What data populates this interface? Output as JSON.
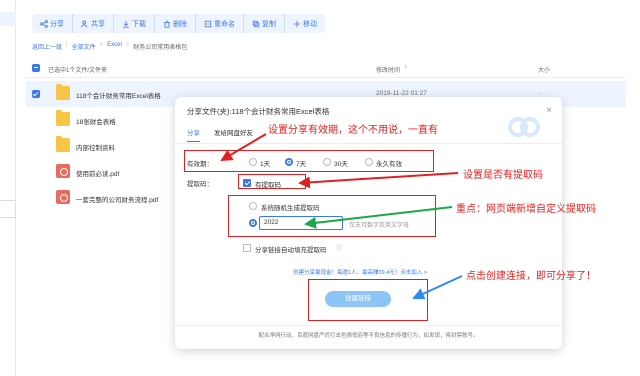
{
  "toolbar": {
    "buttons": [
      {
        "label": "分享",
        "icon": "share-icon"
      },
      {
        "label": "共享",
        "icon": "people-icon"
      },
      {
        "label": "下载",
        "icon": "download-icon"
      },
      {
        "label": "删除",
        "icon": "trash-icon"
      },
      {
        "label": "重命名",
        "icon": "rename-icon"
      },
      {
        "label": "复制",
        "icon": "copy-icon"
      },
      {
        "label": "移动",
        "icon": "move-icon"
      }
    ]
  },
  "breadcrumb": {
    "back": "返回上一级",
    "all": "全部文件",
    "excel": "Excel",
    "current": "财务公司常用表格包"
  },
  "list": {
    "selected_count": "已选中1个文件/文件夹",
    "col_date": "修改时间",
    "col_size": "大小",
    "rows": [
      {
        "name": "118个会计财务常用Excel表格",
        "date": "2019-11-22 01:27",
        "size": "-",
        "type": "folder",
        "selected": true
      },
      {
        "name": "18张财会表格",
        "type": "folder"
      },
      {
        "name": "内部控制资料",
        "type": "folder"
      },
      {
        "name": "使用前必读.pdf",
        "type": "pdf"
      },
      {
        "name": "一套完整的公司财务流程.pdf",
        "type": "pdf"
      }
    ]
  },
  "dialog": {
    "title": "分享文件(夹):118个会计财务常用Excel表格",
    "tabs": [
      "分享",
      "发给网盘好友"
    ],
    "validity_label": "有效期：",
    "validity_options": [
      "1天",
      "7天",
      "30天",
      "永久有效"
    ],
    "extract_label": "提取码：",
    "has_extract": "有提取码",
    "random_code": "系统随机生成提取码",
    "custom_code_value": "2022",
    "custom_code_hint": "仅支持数字及英文字母",
    "auto_fill": "分享链接自动填充提取码",
    "promo": "创建分享赢现金！每邀1人，最高赚39.4元！点击加入 >",
    "create_button": "创建链接",
    "footer": "配合净网行动，百度网盘严厉打击色情低俗等不良信息的传播行为，如发现，将封禁账号。"
  },
  "annotations": {
    "a1": "设置分享有效期，这个不用说，一直有",
    "a2": "设置是否有提取码",
    "a3": "重点：网页端新增自定义提取码",
    "a4": "点击创建连接，即可分享了！"
  },
  "colors": {
    "accent": "#3a78f0",
    "annotation_red": "#e02020",
    "annotation_green": "#1aa84a"
  }
}
